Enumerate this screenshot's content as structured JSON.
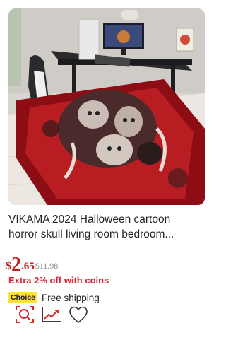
{
  "product": {
    "title_line1": "VIKAMA 2024 Halloween cartoon",
    "title_line2": "horror skull living room bedroom...",
    "price_currency": "$",
    "price_integer": "2",
    "price_decimal": ".65",
    "price_original": "$11.98",
    "discount_text": "Extra 2% off with coins",
    "choice_badge": "Choice",
    "shipping_text": "Free shipping"
  },
  "icons": {
    "image_search": "image-search-icon",
    "price_trend": "price-trend-icon",
    "wishlist": "heart-icon"
  },
  "colors": {
    "price": "#c81a1a",
    "discount": "#d3263a",
    "choice_badge_bg": "#ffe13a",
    "accent_icon": "#e0242b"
  }
}
